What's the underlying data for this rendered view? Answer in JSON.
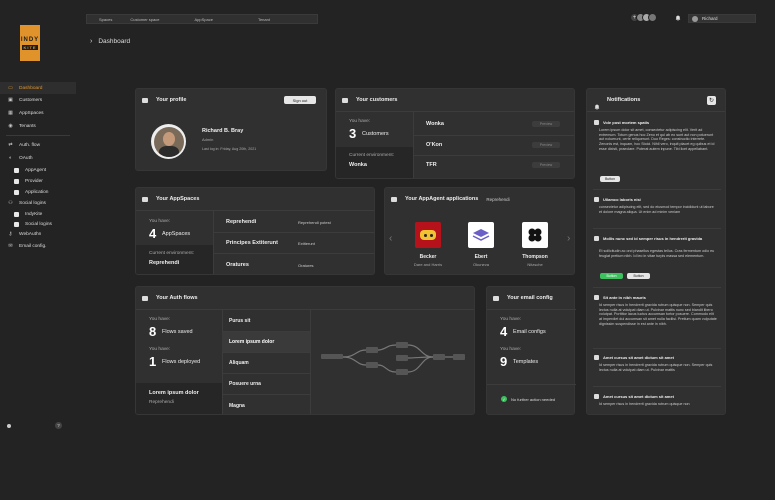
{
  "brand": {
    "line1": "INDY",
    "line2": "KITE"
  },
  "topnav": [
    "Spaces",
    "Customer space",
    "AppSpace",
    "Tenant"
  ],
  "user": {
    "name": "Richard"
  },
  "breadcrumb": {
    "current": "Dashboard"
  },
  "sidebar": {
    "items": [
      {
        "label": "Dashboard",
        "icon": "monitor-icon"
      },
      {
        "label": "Customers",
        "icon": "users-icon"
      },
      {
        "label": "AppSpaces",
        "icon": "apps-icon"
      },
      {
        "label": "Tenants",
        "icon": "eye-icon"
      },
      {
        "label": "Auth. flow",
        "icon": "flow-icon"
      },
      {
        "label": "OAuth",
        "icon": "shield-icon"
      },
      {
        "label": "AppAgent",
        "icon": "square-icon"
      },
      {
        "label": "Provider",
        "icon": "square-icon"
      },
      {
        "label": "Application",
        "icon": "square-icon"
      },
      {
        "label": "Social logins",
        "icon": "network-icon"
      },
      {
        "label": "IndyKite",
        "icon": "square-icon"
      },
      {
        "label": "Social logins",
        "icon": "square-icon"
      },
      {
        "label": "WebAuthn",
        "icon": "key-icon"
      },
      {
        "label": "Email config.",
        "icon": "email-icon"
      }
    ],
    "help": "?"
  },
  "profile": {
    "title": "Your profile",
    "signout": "Sign out",
    "name": "Richard B. Bray",
    "role": "Admin",
    "last_login": "Last log in: Friday, Aug 20th, 2021"
  },
  "customers": {
    "title": "Your customers",
    "have_label": "You have:",
    "count": "3",
    "count_label": "Customers",
    "env_label": "Current environment:",
    "env_value": "Wonka",
    "list": [
      {
        "name": "Wonka",
        "action": "Preview"
      },
      {
        "name": "O'Kon",
        "action": "Preview"
      },
      {
        "name": "TFR",
        "action": "Preview"
      }
    ]
  },
  "appspaces": {
    "title": "Your AppSpaces",
    "have_label": "You have:",
    "count": "4",
    "count_label": "AppSpaces",
    "env_label": "Current environment:",
    "env_value": "Reprehendi",
    "list": [
      {
        "name": "Reprehendi",
        "sub": "Reprehendi potest"
      },
      {
        "name": "Principes Extiterunt",
        "sub": "Extiterunt"
      },
      {
        "name": "Oratures",
        "sub": "Oratures"
      }
    ]
  },
  "appagents": {
    "title": "Your AppAgent applications",
    "context": "Reprehendi",
    "apps": [
      {
        "name": "Becker",
        "sub": "Dare and Harris",
        "color": "#b5121b",
        "icon": "robot-icon"
      },
      {
        "name": "Ebert",
        "sub": "Okuneva",
        "color": "#ffffff",
        "icon": "layers-icon"
      },
      {
        "name": "Thompson",
        "sub": "Nitzsche",
        "color": "#ffffff",
        "icon": "clover-icon"
      }
    ]
  },
  "authflows": {
    "title": "Your Auth flows",
    "have_label1": "You have:",
    "count1": "8",
    "count1_label": "Flows saved",
    "have_label2": "You have:",
    "count2": "1",
    "count2_label": "Flows deployed",
    "footer_title": "Lorem ipsum dolor",
    "footer_sub": "Reprehendi",
    "list": [
      "Purus sit",
      "Lorem ipsum dolor",
      "Aliquam",
      "Posuere urna",
      "Magna"
    ]
  },
  "email": {
    "title": "Your email config",
    "have_label1": "You have:",
    "count1": "4",
    "count1_label": "Email configs",
    "have_label2": "You have:",
    "count2": "9",
    "count2_label": "Templates",
    "status": "No further action needed"
  },
  "notifications": {
    "title": "Notifications",
    "items": [
      {
        "title": "Vole post mortem spatis",
        "body": "Lorem ipsum dolor sit amet, consectetur adipiscing elit. Verit ad extremum. Totum genus hoc Zeno et qui ab eo sunt aut non potuerunt aut noluerunt, certe reliquerunt. Duo Reges: constructio interrete. Zenonis est, inquam, hoc Stoici. Nihil vero, inquit placet eg quibus et id esse dixisti, praeclare. Poterat autem inpune. Tibi licet appellabant.",
        "buttons": [
          "Button"
        ]
      },
      {
        "title": "Ullamco laboris nisi",
        "body": "consectetur adipiscing elit, sed do eiusmod tempor incididunt ut labore et dolore magna aliqua. Ut enim ad minim veniam",
        "buttons": []
      },
      {
        "title": "Mollis nunc sed id semper risus in hendrerit gravida",
        "body": "Et sollicitudin ac orci phasellus egestas tellus. Cras fermentum odio eu feugiat pretium nibh. Id leo in vitae turpis massa sed elementum.",
        "buttons": [
          "Button",
          "Button"
        ]
      },
      {
        "title": "Sit ante in nibh mauris",
        "body": "Id semper risus in hendrerit gravida rutrum quisque non. Semper quis lectus nulla at volutpat diam ut. Pulvinar mattis nunc sed blandit libero volutpat. Porttitor lacus luctus accumsan tortor posuere. Commodo elit at imperdiet dui accumsan sit amet nulla facilisi. Pretium quam vulputate dignissim suspendisse in est ante in nibh.",
        "buttons": []
      },
      {
        "title": "Amet cursus sit amet dictum sit amet",
        "body": "Id semper risus in hendrerit gravida rutrum quisque non. Semper quis lectus nulla at volutpat diam ut. Pulvinar mattis",
        "buttons": []
      },
      {
        "title": "Amet cursus sit amet dictum sit amet",
        "body": "Id semper risus in hendrerit gravida rutrum quisque non",
        "buttons": []
      }
    ]
  },
  "colors": {
    "accent": "#e0932a",
    "success": "#3cc15e"
  }
}
